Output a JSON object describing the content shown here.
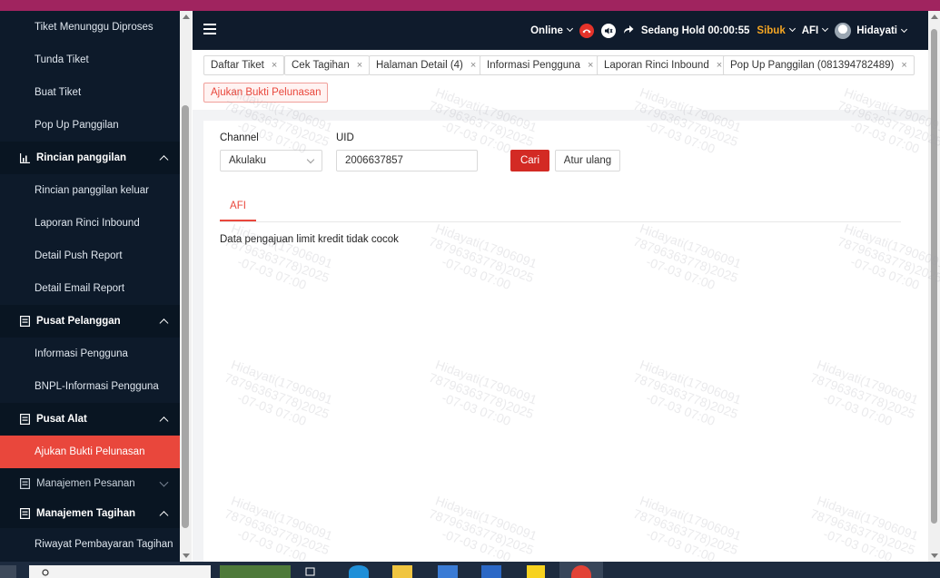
{
  "sidebar": {
    "items": [
      {
        "type": "sub",
        "label": "Tiket Menunggu Diproses"
      },
      {
        "type": "sub",
        "label": "Tunda Tiket"
      },
      {
        "type": "sub",
        "label": "Buat Tiket"
      },
      {
        "type": "sub",
        "label": "Pop Up Panggilan"
      },
      {
        "type": "group",
        "label": "Rincian panggilan",
        "icon": "bar-chart-icon",
        "expanded": true
      },
      {
        "type": "sub",
        "label": "Rincian panggilan keluar"
      },
      {
        "type": "sub",
        "label": "Laporan Rinci Inbound"
      },
      {
        "type": "sub",
        "label": "Detail Push Report"
      },
      {
        "type": "sub",
        "label": "Detail Email Report"
      },
      {
        "type": "group",
        "label": "Pusat Pelanggan",
        "icon": "document-icon",
        "expanded": true
      },
      {
        "type": "sub",
        "label": "Informasi Pengguna"
      },
      {
        "type": "sub",
        "label": "BNPL-Informasi Pengguna"
      },
      {
        "type": "group",
        "label": "Pusat Alat",
        "icon": "document-icon",
        "expanded": true
      },
      {
        "type": "sub",
        "label": "Ajukan Bukti Pelunasan",
        "active": true
      },
      {
        "type": "group",
        "label": "Manajemen Pesanan",
        "icon": "document-icon",
        "expanded": false
      },
      {
        "type": "group",
        "label": "Manajemen Tagihan",
        "icon": "document-icon",
        "expanded": true
      },
      {
        "type": "sub",
        "label": "Riwayat Pembayaran Tagihan"
      }
    ]
  },
  "header": {
    "status": "Online",
    "hold_label": "Sedang Hold 00:00:55",
    "busy_label": "Sibuk",
    "team": "AFI",
    "user": "Hidayati"
  },
  "tabs": [
    {
      "label": "Daftar Tiket"
    },
    {
      "label": "Cek Tagihan"
    },
    {
      "label": "Halaman Detail (4)"
    },
    {
      "label": "Informasi Pengguna"
    },
    {
      "label": "Laporan Rinci Inbound"
    },
    {
      "label": "Pop Up Panggilan (081394782489)"
    },
    {
      "label": "Ajukan Bukti Pelunasan",
      "active": true
    }
  ],
  "form": {
    "channel_label": "Channel",
    "channel_value": "Akulaku",
    "uid_label": "UID",
    "uid_value": "2006637857",
    "search_button": "Cari",
    "reset_button": "Atur ulang"
  },
  "result": {
    "tab_label": "AFI",
    "message": "Data pengajuan limit kredit tidak cocok"
  },
  "watermark": {
    "line1": "Hidayati(17906091",
    "line2": "78796363778)2025",
    "line3": "-07-03 07:00"
  },
  "colors": {
    "accent": "#e9473c",
    "primary_button": "#d32a24",
    "sidebar_bg": "#0d1a2a",
    "header_bg": "#0f1b2c",
    "busy": "#f5a623"
  }
}
